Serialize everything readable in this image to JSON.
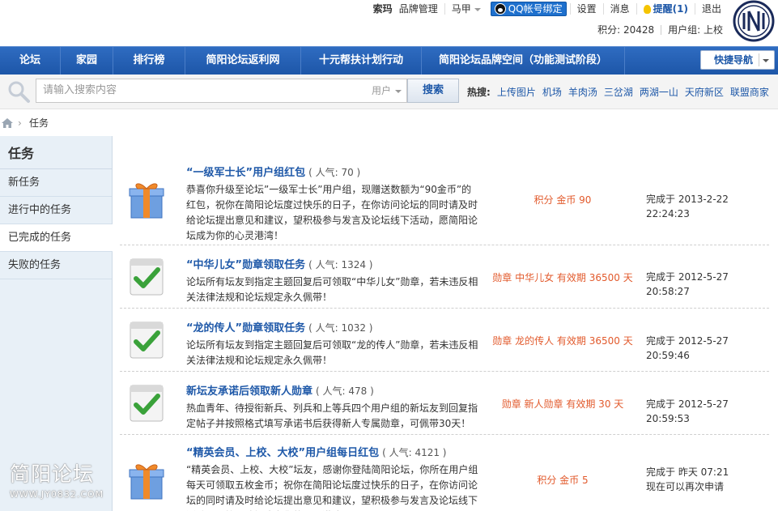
{
  "topbar": {
    "username": "索玛",
    "brand_manage": "品牌管理",
    "horse": "马甲",
    "qq_bind": "QQ帐号绑定",
    "settings": "设置",
    "messages": "消息",
    "remind": "提醒(1)",
    "logout": "退出",
    "points": "积分: 20428",
    "usergroup": "用户组: 上校"
  },
  "nav": {
    "items": [
      "论坛",
      "家园",
      "排行榜",
      "简阳论坛返利网",
      "十元帮扶计划行动",
      "简阳论坛品牌空间（功能测试阶段）"
    ],
    "quick": "快捷导航"
  },
  "search": {
    "placeholder": "请输入搜索内容",
    "type": "用户",
    "button": "搜索",
    "hot_label": "热搜:",
    "hot": [
      "上传图片",
      "机场",
      "羊肉汤",
      "三岔湖",
      "两湖一山",
      "天府新区",
      "联盟商家"
    ]
  },
  "breadcrumb": {
    "current": "任务"
  },
  "sidebar": {
    "title": "任务",
    "items": [
      "新任务",
      "进行中的任务",
      "已完成的任务",
      "失败的任务"
    ],
    "active_index": 2
  },
  "tasks": [
    {
      "title": "“一级军士长”用户组红包",
      "popularity": "( 人气: 70 )",
      "desc": "恭喜你升级至论坛”一级军士长”用户组，现赠送数额为“90金币”的红包，祝你在简阳论坛度过快乐的日子，在你访问论坛的同时请及时给论坛提出意见和建议，望积极参与发言及论坛线下活动，愿简阳论坛成为你的心灵港湾！",
      "reward": "积分 金币 90",
      "status1": "完成于 2013-2-22 22:24:23",
      "status2": "",
      "icon": "gift-icon"
    },
    {
      "title": "“中华儿女”勋章领取任务",
      "popularity": "( 人气: 1324 )",
      "desc": "论坛所有坛友到指定主题回复后可领取“中华儿女”勋章，若未违反相关法律法规和论坛规定永久佩带！",
      "reward": "勋章 中华儿女 有效期 36500 天",
      "status1": "完成于 2012-5-27 20:58:27",
      "status2": "",
      "icon": "check-icon"
    },
    {
      "title": "“龙的传人”勋章领取任务",
      "popularity": "( 人气: 1032 )",
      "desc": "论坛所有坛友到指定主题回复后可领取“龙的传人”勋章，若未违反相关法律法规和论坛规定永久佩带！",
      "reward": "勋章 龙的传人 有效期 36500 天",
      "status1": "完成于 2012-5-27 20:59:46",
      "status2": "",
      "icon": "check-icon"
    },
    {
      "title": "新坛友承诺后领取新人勋章",
      "popularity": "( 人气: 478 )",
      "desc": "热血青年、待授衔新兵、列兵和上等兵四个用户组的新坛友到回复指定帖子并按照格式填写承诺书后获得新人专属勋章，可佩带30天！",
      "reward": "勋章 新人勋章 有效期 30 天",
      "status1": "完成于 2012-5-27 20:59:53",
      "status2": "",
      "icon": "check-icon"
    },
    {
      "title": "“精英会员、上校、大校”用户组每日红包",
      "popularity": "( 人气: 4121 )",
      "desc": "“精英会员、上校、大校”坛友，感谢你登陆简阳论坛，你所在用户组每天可领取五枚金币；祝你在简阳论坛度过快乐的日子，在你访问论坛的同时请及时给论坛提出意见和建议，望积极参与发言及论坛线下活动，愿简阳论坛成为你的心灵港湾！",
      "reward": "积分 金币 5",
      "status1": "完成于 昨天 07:21",
      "status2": "现在可以再次申请",
      "icon": "gift-icon"
    }
  ],
  "watermark": {
    "line1": "简阳论坛",
    "line2": "WWW.JY0832.COM"
  }
}
